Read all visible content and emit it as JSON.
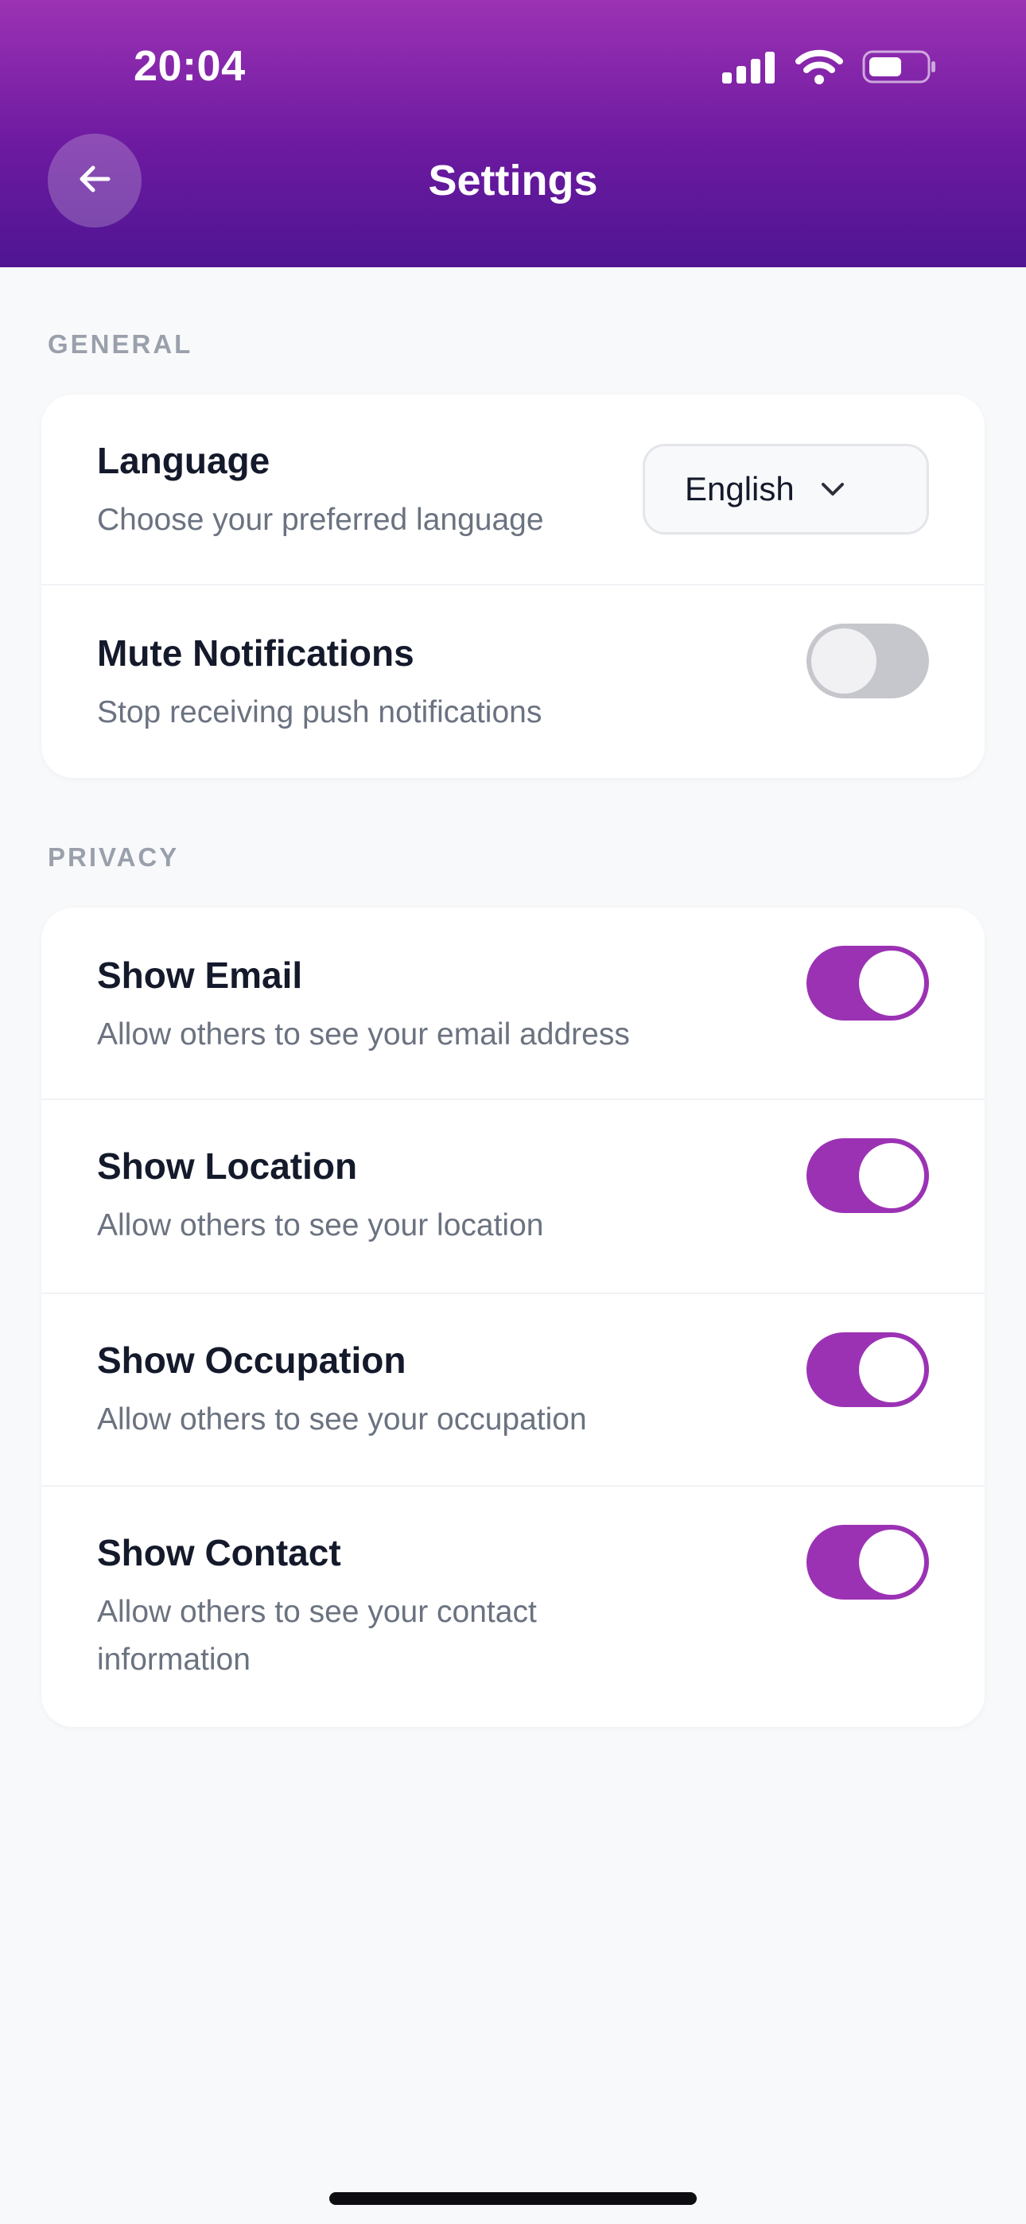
{
  "status_bar": {
    "time": "20:04"
  },
  "header": {
    "title": "Settings",
    "back_icon": "arrow-left-icon",
    "gradient": [
      "#9c32b4",
      "#4f1592"
    ]
  },
  "sections": {
    "general": {
      "label": "GENERAL",
      "language": {
        "title": "Language",
        "description": "Choose your preferred language",
        "selected": "English"
      },
      "mute_notifications": {
        "title": "Mute Notifications",
        "description": "Stop receiving push notifications",
        "enabled": false
      }
    },
    "privacy": {
      "label": "PRIVACY",
      "show_email": {
        "title": "Show Email",
        "description": "Allow others to see your email address",
        "enabled": true
      },
      "show_location": {
        "title": "Show Location",
        "description": "Allow others to see your location",
        "enabled": true
      },
      "show_occupation": {
        "title": "Show Occupation",
        "description": "Allow others to see your occupation",
        "enabled": true
      },
      "show_contact": {
        "title": "Show Contact",
        "description": "Allow others to see your contact information",
        "enabled": true
      }
    }
  },
  "colors": {
    "accent": "#9b32b4",
    "toggle_off": "#c5c7cc",
    "background": "#f8f9fb"
  }
}
